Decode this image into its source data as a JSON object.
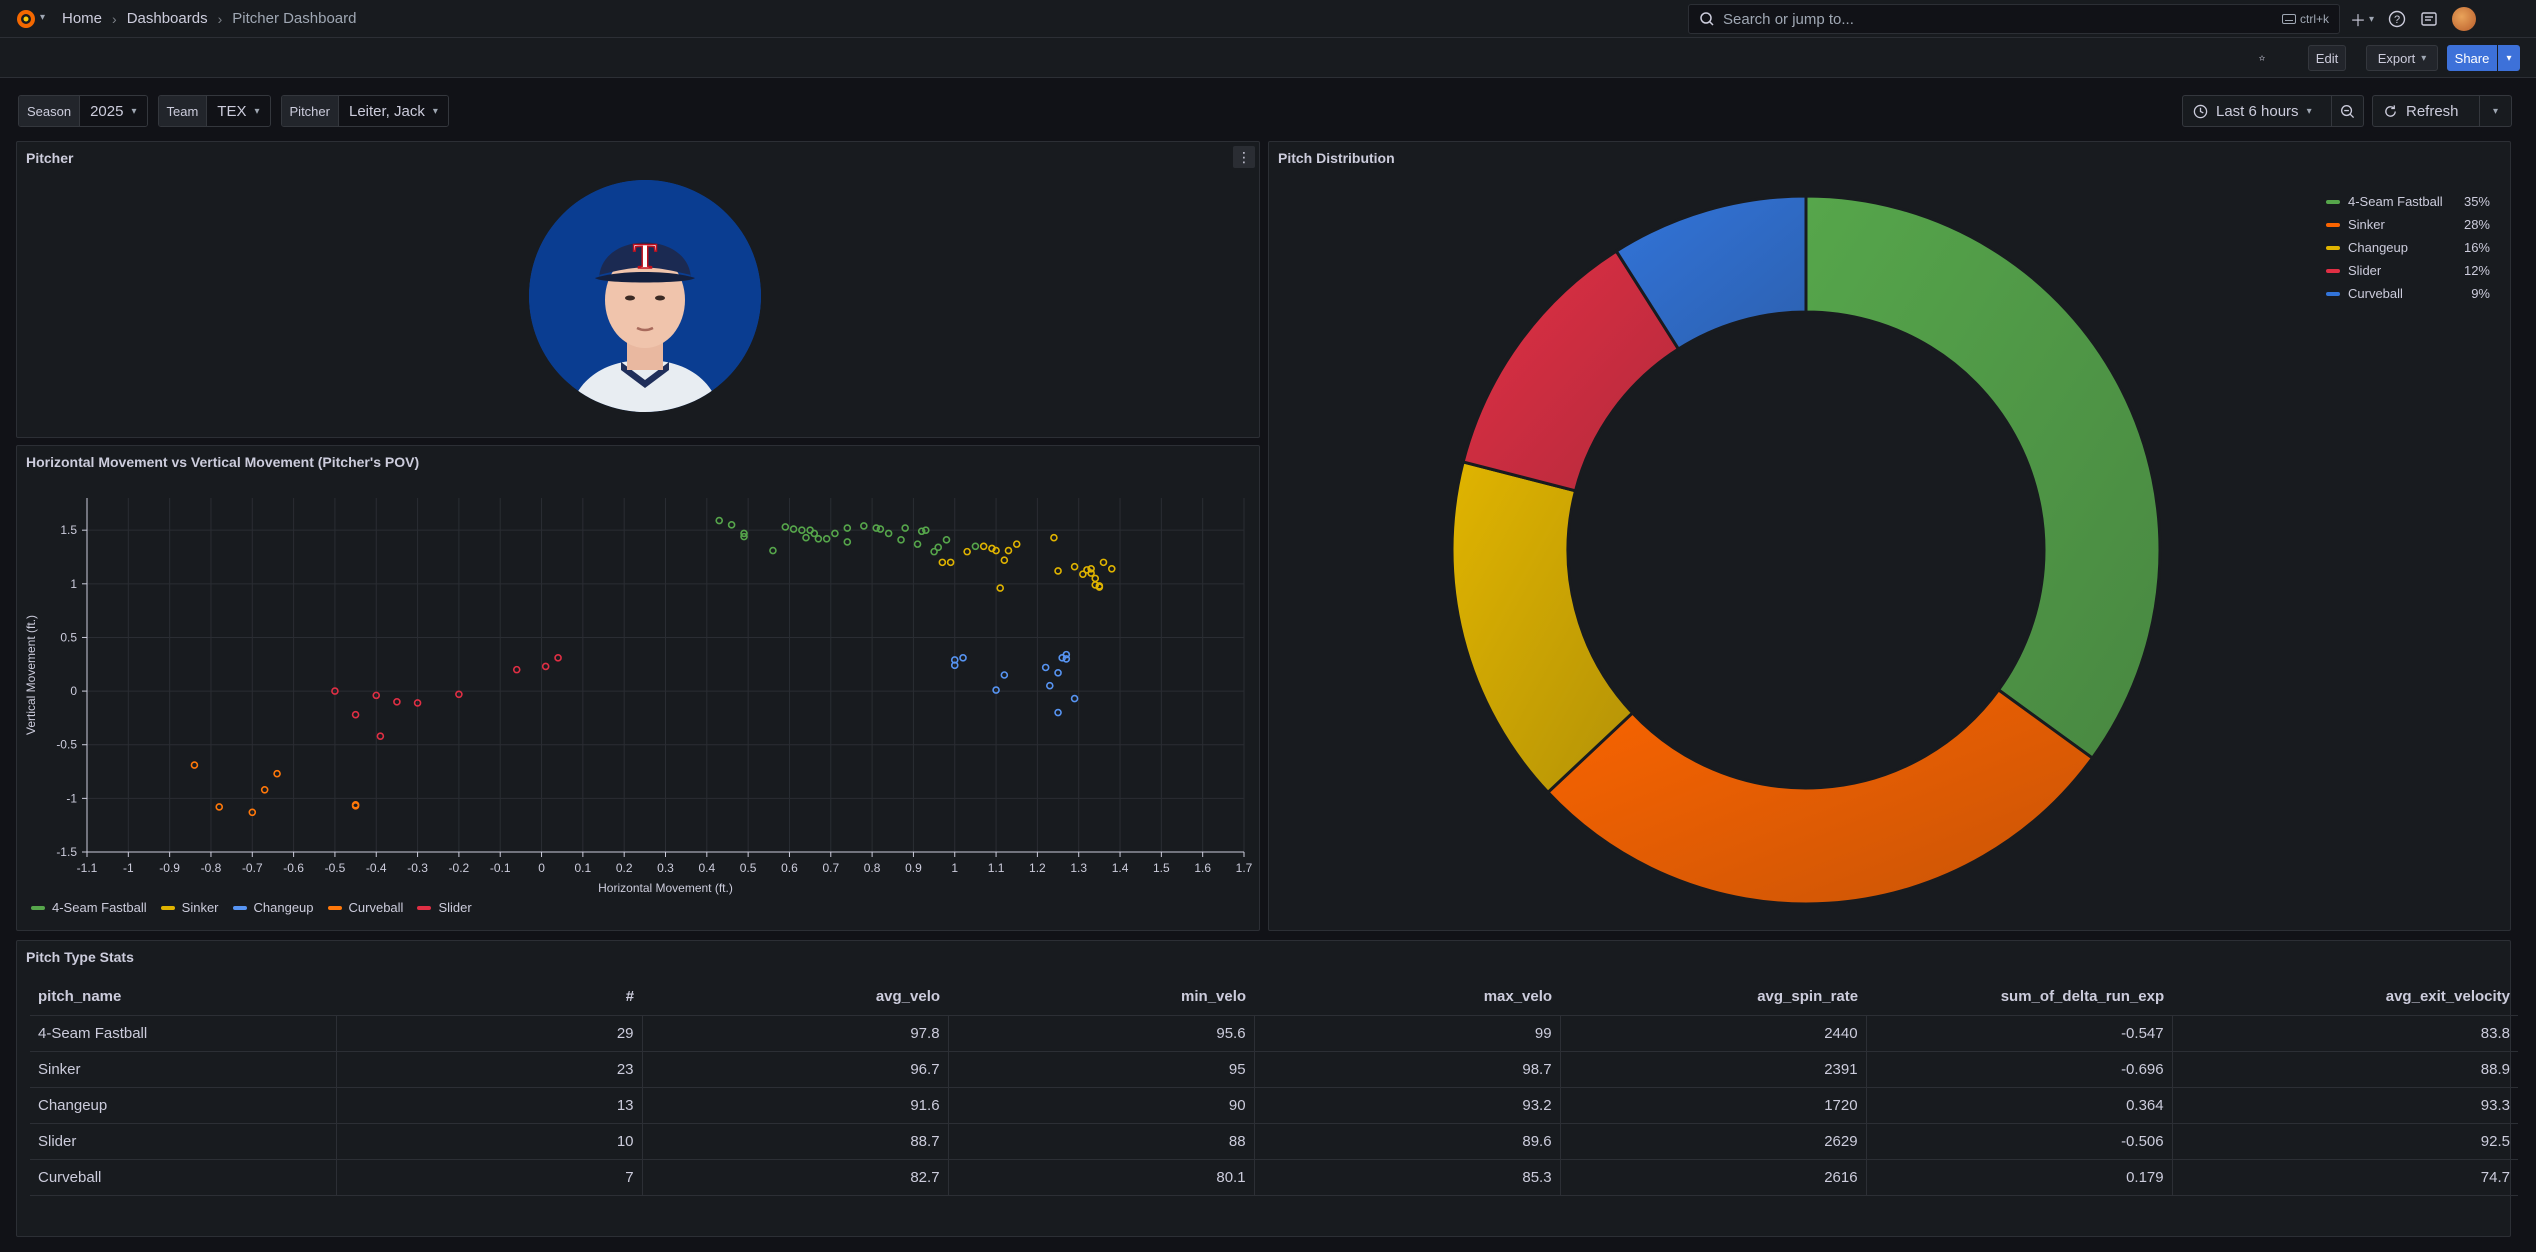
{
  "topbar": {
    "breadcrumbs": [
      "Home",
      "Dashboards",
      "Pitcher Dashboard"
    ],
    "search_placeholder": "Search or jump to...",
    "search_shortcut": "ctrl+k"
  },
  "actions": {
    "edit": "Edit",
    "export": "Export",
    "share": "Share"
  },
  "variables": [
    {
      "label": "Season",
      "value": "2025"
    },
    {
      "label": "Team",
      "value": "TEX"
    },
    {
      "label": "Pitcher",
      "value": "Leiter, Jack"
    }
  ],
  "time": {
    "range": "Last 6 hours",
    "refresh": "Refresh"
  },
  "colors": {
    "fastball": "#56a64b",
    "sinker": "#e0b400",
    "changeup": "#5794f2",
    "curveball": "#ff780a",
    "slider": "#e02f44",
    "sinker_donut": "#fa6400",
    "changeup_donut": "#e0b400",
    "slider_donut": "#e02f44",
    "curveball_donut": "#3274d9"
  },
  "panels": {
    "pitcher": {
      "title": "Pitcher"
    },
    "movement": {
      "title": "Horizontal Movement vs Vertical Movement (Pitcher's POV)"
    },
    "distribution": {
      "title": "Pitch Distribution"
    },
    "stats": {
      "title": "Pitch Type Stats"
    }
  },
  "chart_data": [
    {
      "type": "scatter",
      "title": "Horizontal Movement vs Vertical Movement (Pitcher's POV)",
      "xlabel": "Horizontal Movement (ft.)",
      "ylabel": "Vertical Movement (ft.)",
      "xlim": [
        -1.1,
        1.7
      ],
      "ylim": [
        -1.5,
        1.8
      ],
      "x_ticks": [
        "-1.1",
        "-1",
        "-0.9",
        "-0.8",
        "-0.7",
        "-0.6",
        "-0.5",
        "-0.4",
        "-0.3",
        "-0.2",
        "-0.1",
        "0",
        "0.1",
        "0.2",
        "0.3",
        "0.4",
        "0.5",
        "0.6",
        "0.7",
        "0.8",
        "0.9",
        "1",
        "1.1",
        "1.2",
        "1.3",
        "1.4",
        "1.5",
        "1.6",
        "1.7"
      ],
      "y_ticks": [
        "1.5",
        "1",
        "0.5",
        "0",
        "-0.5",
        "-1",
        "-1.5"
      ],
      "grid": true,
      "legend_position": "bottom",
      "series": [
        {
          "name": "4-Seam Fastball",
          "color": "#56a64b",
          "points": [
            [
              0.43,
              1.59
            ],
            [
              0.46,
              1.55
            ],
            [
              0.49,
              1.47
            ],
            [
              0.49,
              1.44
            ],
            [
              0.56,
              1.31
            ],
            [
              0.59,
              1.53
            ],
            [
              0.61,
              1.51
            ],
            [
              0.63,
              1.5
            ],
            [
              0.64,
              1.43
            ],
            [
              0.65,
              1.5
            ],
            [
              0.66,
              1.47
            ],
            [
              0.67,
              1.42
            ],
            [
              0.69,
              1.42
            ],
            [
              0.71,
              1.47
            ],
            [
              0.74,
              1.39
            ],
            [
              0.74,
              1.52
            ],
            [
              0.78,
              1.54
            ],
            [
              0.81,
              1.52
            ],
            [
              0.82,
              1.51
            ],
            [
              0.84,
              1.47
            ],
            [
              0.87,
              1.41
            ],
            [
              0.88,
              1.52
            ],
            [
              0.91,
              1.37
            ],
            [
              0.92,
              1.49
            ],
            [
              0.93,
              1.5
            ],
            [
              0.95,
              1.3
            ],
            [
              0.96,
              1.34
            ],
            [
              0.98,
              1.41
            ],
            [
              1.05,
              1.35
            ]
          ]
        },
        {
          "name": "Sinker",
          "color": "#e0b400",
          "points": [
            [
              0.97,
              1.2
            ],
            [
              0.99,
              1.2
            ],
            [
              1.03,
              1.3
            ],
            [
              1.07,
              1.35
            ],
            [
              1.09,
              1.33
            ],
            [
              1.1,
              1.31
            ],
            [
              1.12,
              1.22
            ],
            [
              1.13,
              1.31
            ],
            [
              1.15,
              1.37
            ],
            [
              1.11,
              0.96
            ],
            [
              1.24,
              1.43
            ],
            [
              1.25,
              1.12
            ],
            [
              1.29,
              1.16
            ],
            [
              1.31,
              1.09
            ],
            [
              1.32,
              1.13
            ],
            [
              1.33,
              1.1
            ],
            [
              1.34,
              1.05
            ],
            [
              1.34,
              0.99
            ],
            [
              1.35,
              0.98
            ],
            [
              1.36,
              1.2
            ],
            [
              1.38,
              1.14
            ],
            [
              1.35,
              0.97
            ],
            [
              1.33,
              1.14
            ]
          ]
        },
        {
          "name": "Changeup",
          "color": "#5794f2",
          "points": [
            [
              1.0,
              0.24
            ],
            [
              1.0,
              0.29
            ],
            [
              1.02,
              0.31
            ],
            [
              1.1,
              0.01
            ],
            [
              1.12,
              0.15
            ],
            [
              1.22,
              0.22
            ],
            [
              1.23,
              0.05
            ],
            [
              1.25,
              -0.2
            ],
            [
              1.25,
              0.17
            ],
            [
              1.26,
              0.31
            ],
            [
              1.27,
              0.34
            ],
            [
              1.29,
              -0.07
            ],
            [
              1.27,
              0.3
            ]
          ]
        },
        {
          "name": "Curveball",
          "color": "#ff780a",
          "points": [
            [
              -0.84,
              -0.69
            ],
            [
              -0.78,
              -1.08
            ],
            [
              -0.7,
              -1.13
            ],
            [
              -0.67,
              -0.92
            ],
            [
              -0.64,
              -0.77
            ],
            [
              -0.45,
              -1.07
            ],
            [
              -0.45,
              -1.06
            ]
          ]
        },
        {
          "name": "Slider",
          "color": "#e02f44",
          "points": [
            [
              -0.5,
              0.0
            ],
            [
              -0.45,
              -0.22
            ],
            [
              -0.4,
              -0.04
            ],
            [
              -0.39,
              -0.42
            ],
            [
              -0.35,
              -0.1
            ],
            [
              -0.3,
              -0.11
            ],
            [
              -0.2,
              -0.03
            ],
            [
              -0.06,
              0.2
            ],
            [
              0.01,
              0.23
            ],
            [
              0.04,
              0.31
            ]
          ]
        }
      ]
    },
    {
      "type": "pie",
      "title": "Pitch Distribution",
      "legend_position": "top-right",
      "slices": [
        {
          "name": "4-Seam Fastball",
          "value": 35,
          "label": "35%",
          "color": "#56a64b"
        },
        {
          "name": "Sinker",
          "value": 28,
          "label": "28%",
          "color": "#fa6400"
        },
        {
          "name": "Changeup",
          "value": 16,
          "label": "16%",
          "color": "#e0b400"
        },
        {
          "name": "Slider",
          "value": 12,
          "label": "12%",
          "color": "#e02f44"
        },
        {
          "name": "Curveball",
          "value": 9,
          "label": "9%",
          "color": "#3274d9"
        }
      ]
    },
    {
      "type": "table",
      "title": "Pitch Type Stats",
      "columns": [
        "pitch_name",
        "#",
        "avg_velo",
        "min_velo",
        "max_velo",
        "avg_spin_rate",
        "sum_of_delta_run_exp",
        "avg_exit_velocity"
      ],
      "rows": [
        [
          "4-Seam Fastball",
          "29",
          "97.8",
          "95.6",
          "99",
          "2440",
          "-0.547",
          "83.8"
        ],
        [
          "Sinker",
          "23",
          "96.7",
          "95",
          "98.7",
          "2391",
          "-0.696",
          "88.9"
        ],
        [
          "Changeup",
          "13",
          "91.6",
          "90",
          "93.2",
          "1720",
          "0.364",
          "93.3"
        ],
        [
          "Slider",
          "10",
          "88.7",
          "88",
          "89.6",
          "2629",
          "-0.506",
          "92.5"
        ],
        [
          "Curveball",
          "7",
          "82.7",
          "80.1",
          "85.3",
          "2616",
          "0.179",
          "74.7"
        ]
      ]
    }
  ]
}
